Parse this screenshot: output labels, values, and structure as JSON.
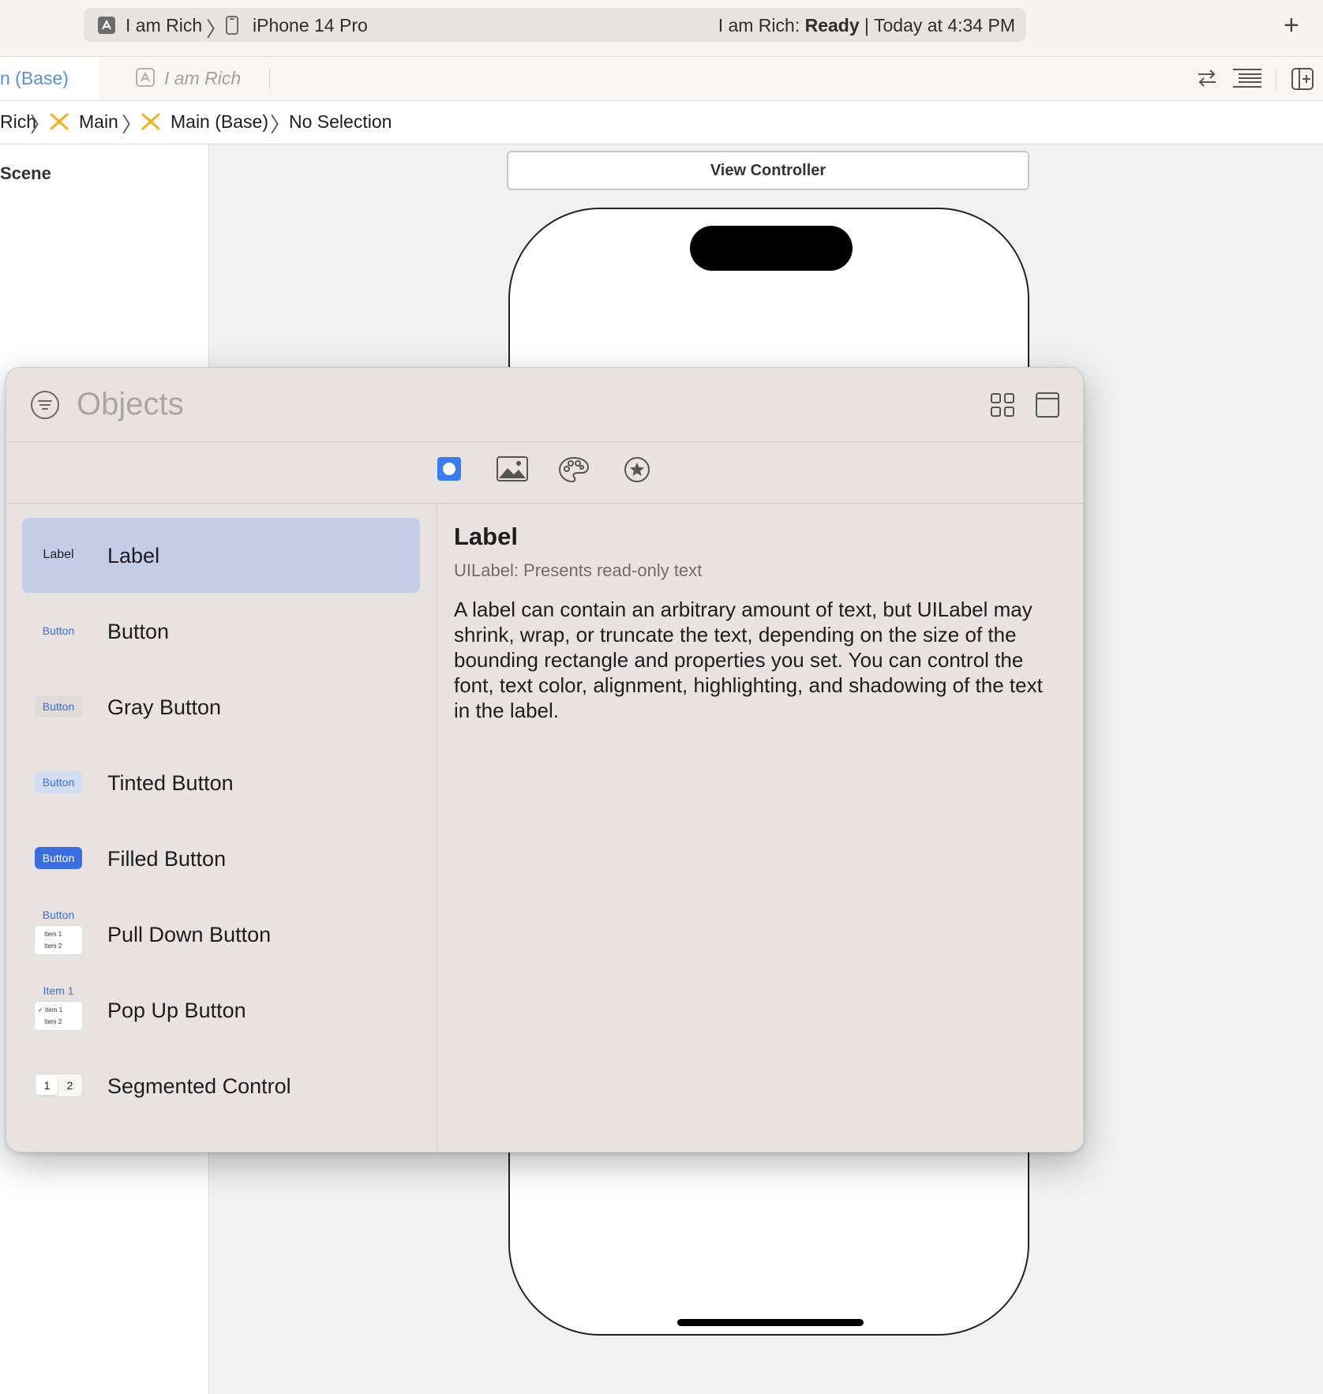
{
  "toolbar": {
    "scheme": "I am Rich",
    "device": "iPhone 14 Pro",
    "status_prefix": "I am Rich: ",
    "status_state": "Ready",
    "status_suffix": " | Today at 4:34 PM",
    "add_label": "+",
    "icons": [
      "app-icon",
      "iphone-icon",
      "plus-icon"
    ]
  },
  "tabs": {
    "active_label": "n (Base)",
    "second_label": "I am Rich",
    "right_icons": [
      "swap-arrows-icon",
      "lines-icon",
      "add-editor-icon"
    ]
  },
  "jumpbar": {
    "items": [
      "Rich",
      "Main",
      "Main (Base)",
      "No Selection"
    ],
    "accent_color": "#f3b11d"
  },
  "outline": {
    "scene_title": "Scene"
  },
  "canvas": {
    "scene_header": "View Controller"
  },
  "library": {
    "search_placeholder": "Objects",
    "segment_icons": [
      "objects-icon",
      "image-icon",
      "palette-icon",
      "star-icon"
    ],
    "selected_segment": 0,
    "accent_color": "#3b7bf0",
    "items": [
      {
        "name": "Label",
        "thumb": "Label",
        "selected": true
      },
      {
        "name": "Button",
        "thumb": "Button"
      },
      {
        "name": "Gray Button",
        "thumb": "Button"
      },
      {
        "name": "Tinted Button",
        "thumb": "Button"
      },
      {
        "name": "Filled Button",
        "thumb": "Button"
      },
      {
        "name": "Pull Down Button",
        "thumb": "Button",
        "menu_items": [
          "Item 1",
          "Item 2"
        ]
      },
      {
        "name": "Pop Up Button",
        "thumb": "Item 1",
        "menu_items": [
          "✓ Item 1",
          "Item 2"
        ]
      },
      {
        "name": "Segmented Control",
        "segments": [
          "1",
          "2"
        ]
      }
    ],
    "detail": {
      "title": "Label",
      "subtitle": "UILabel: Presents read-only text",
      "description": "A label can contain an arbitrary amount of text, but UILabel may shrink, wrap, or truncate the text, depending on the size of the bounding rectangle and properties you set. You can control the font, text color, alignment, highlighting, and shadowing of the text in the label."
    }
  }
}
